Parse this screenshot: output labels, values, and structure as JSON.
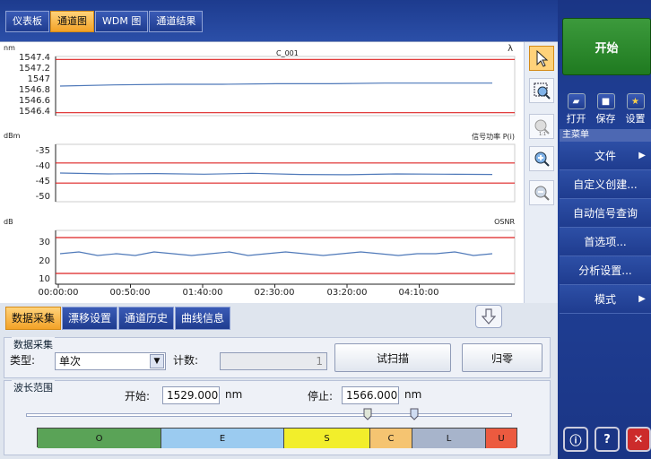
{
  "top_tabs": [
    "仪表板",
    "通道图",
    "WDM 图",
    "通道结果"
  ],
  "top_tabs_active": 1,
  "plot": {
    "title": "C_001",
    "top_right": "λ",
    "panels": [
      {
        "unit": "nm",
        "label": "",
        "ticks": [
          "1547.4",
          "1547.2",
          "1547",
          "1546.8",
          "1546.6",
          "1546.4"
        ],
        "limits": [
          1547.4,
          1546.4
        ],
        "red_lines": [
          1547.35,
          1546.45
        ],
        "trace": [
          1546.9,
          1546.92,
          1546.93,
          1546.93,
          1546.94,
          1546.94,
          1546.95,
          1546.95,
          1546.95
        ]
      },
      {
        "unit": "dBm",
        "label": "信号功率 P(i)",
        "ticks": [
          "-35",
          "-40",
          "-45",
          "-50"
        ],
        "limits": [
          -32,
          -52
        ],
        "red_lines": [
          -38.5,
          -45.5
        ],
        "trace": [
          -42.0,
          -42.3,
          -42.2,
          -42.4,
          -42.1,
          -42.5,
          -42.6,
          -42.3,
          -42.4,
          -42.5
        ]
      },
      {
        "unit": "dB",
        "label": "OSNR",
        "ticks": [
          "30",
          "20",
          "10"
        ],
        "limits": [
          37,
          7
        ],
        "red_lines": [
          33,
          13
        ],
        "trace": [
          24,
          25,
          23,
          24,
          23,
          25,
          24,
          23,
          24,
          25,
          23,
          24,
          25,
          24,
          23,
          24,
          25,
          24,
          23,
          24,
          24,
          25,
          23,
          24
        ]
      }
    ],
    "x_ticks": [
      "00:00:00",
      "00:50:00",
      "01:40:00",
      "02:30:00",
      "03:20:00",
      "04:10:00"
    ]
  },
  "bottom_tabs": [
    "数据采集",
    "漂移设置",
    "通道历史",
    "曲线信息"
  ],
  "bottom_tabs_active": 0,
  "acquisition": {
    "group_title": "数据采集",
    "type_label": "类型:",
    "type_value": "单次",
    "count_label": "计数:",
    "count_value": "1",
    "trial_scan": "试扫描",
    "zero": "归零"
  },
  "wavelength": {
    "group_title": "波长范围",
    "start_label": "开始:",
    "start_value": "1529.000",
    "stop_label": "停止:",
    "stop_value": "1566.000",
    "unit": "nm",
    "bands": [
      {
        "name": "O",
        "color": "#5aa357"
      },
      {
        "name": "E",
        "color": "#9bcbf0"
      },
      {
        "name": "S",
        "color": "#f2ee2b"
      },
      {
        "name": "C",
        "color": "#f5c471"
      },
      {
        "name": "L",
        "color": "#a7b4cb"
      },
      {
        "name": "U",
        "color": "#ec5a3f"
      }
    ]
  },
  "right_panel": {
    "start": "开始",
    "open": "打开",
    "save": "保存",
    "settings": "设置",
    "main_menu": "主菜单",
    "menu_items": [
      "文件",
      "自定义创建...",
      "自动信号查询",
      "首选项...",
      "分析设置...",
      "模式"
    ]
  }
}
